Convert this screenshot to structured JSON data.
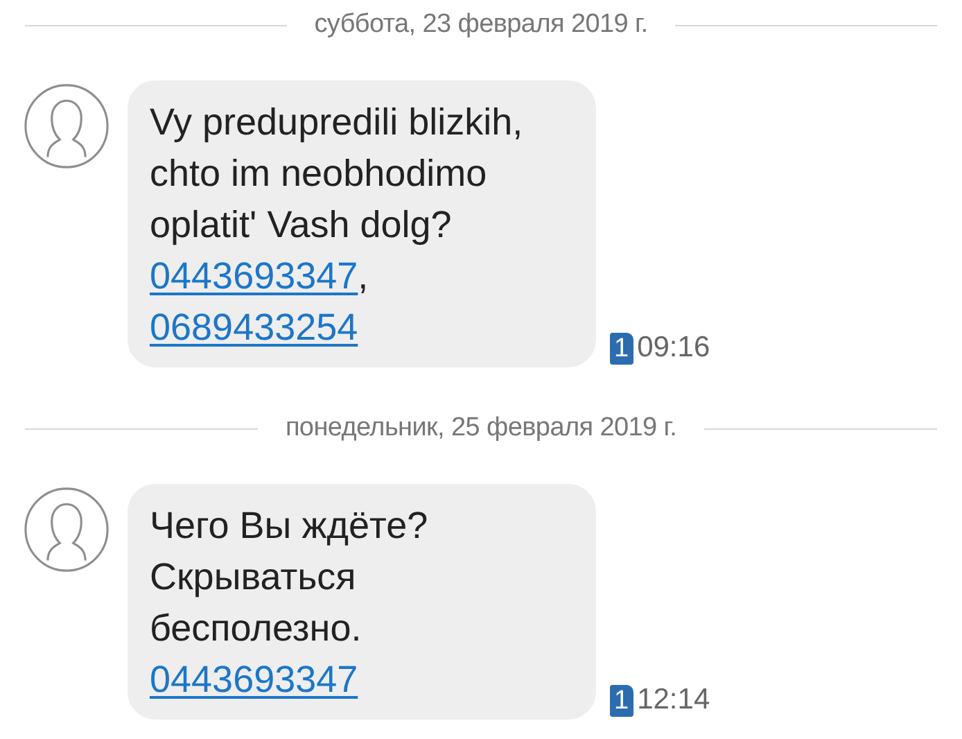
{
  "messages": [
    {
      "date": "суббота, 23 февраля 2019 г.",
      "lines": [
        [
          {
            "kind": "text",
            "text": "Vy predupredili blizkih,"
          }
        ],
        [
          {
            "kind": "text",
            "text": "chto im neobhodimo"
          }
        ],
        [
          {
            "kind": "text",
            "text": "oplatit' Vash dolg?"
          }
        ],
        [
          {
            "kind": "link",
            "text": "0443693347"
          },
          {
            "kind": "text",
            "text": ","
          }
        ],
        [
          {
            "kind": "link",
            "text": "0689433254"
          }
        ]
      ],
      "sim": "1",
      "time": "09:16"
    },
    {
      "date": "понедельник, 25 февраля 2019 г.",
      "lines": [
        [
          {
            "kind": "text",
            "text": "Чего Вы ждёте?"
          }
        ],
        [
          {
            "kind": "text",
            "text": "Скрываться"
          }
        ],
        [
          {
            "kind": "text",
            "text": "бесполезно."
          }
        ],
        [
          {
            "kind": "link",
            "text": "0443693347"
          }
        ]
      ],
      "sim": "1",
      "time": "12:14"
    }
  ]
}
